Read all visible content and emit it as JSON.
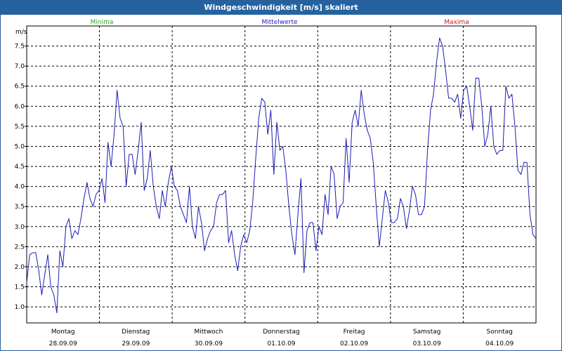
{
  "window": {
    "title": "Windgeschwindigkeit [m/s] skaliert"
  },
  "legend": {
    "min_label": "Minima",
    "mean_label": "Mittelwerte",
    "max_label": "Maxima",
    "min_color": "#22aa22",
    "mean_color": "#2020c0",
    "max_color": "#c02020"
  },
  "chart_data": {
    "type": "line",
    "title": "Windgeschwindigkeit [m/s] skaliert",
    "xlabel": "",
    "ylabel": "m/s",
    "ylim": [
      0.6,
      8.0
    ],
    "y_ticks": [
      "1.0",
      "1.5",
      "2.0",
      "2.5",
      "3.0",
      "3.5",
      "4.0",
      "4.5",
      "5.0",
      "5.5",
      "6.0",
      "6.5",
      "7.0",
      "7.5"
    ],
    "x_range_days": [
      0,
      7
    ],
    "day_labels": [
      {
        "day": "Montag",
        "date": "28.09.09"
      },
      {
        "day": "Dienstag",
        "date": "29.09.09"
      },
      {
        "day": "Mittwoch",
        "date": "30.09.09"
      },
      {
        "day": "Donnerstag",
        "date": "01.10.09"
      },
      {
        "day": "Freitag",
        "date": "02.10.09"
      },
      {
        "day": "Samstag",
        "date": "03.10.09"
      },
      {
        "day": "Sonntag",
        "date": "04.10.09"
      }
    ],
    "grid": true,
    "series": [
      {
        "name": "Mittelwerte",
        "color": "#1c1cb4",
        "values": [
          1.6,
          2.3,
          2.35,
          2.35,
          1.9,
          1.3,
          1.8,
          2.3,
          1.5,
          1.3,
          0.85,
          2.4,
          2.0,
          3.0,
          3.2,
          2.7,
          2.9,
          2.8,
          3.2,
          3.7,
          4.1,
          3.7,
          3.5,
          3.8,
          3.9,
          4.2,
          3.6,
          5.1,
          4.5,
          5.3,
          6.4,
          5.7,
          5.5,
          4.0,
          4.8,
          4.8,
          4.3,
          4.9,
          5.6,
          3.9,
          4.2,
          4.9,
          4.0,
          3.5,
          3.2,
          3.9,
          3.5,
          4.1,
          4.5,
          4.0,
          3.9,
          3.5,
          3.3,
          3.1,
          4.0,
          3.0,
          2.7,
          3.5,
          3.1,
          2.4,
          2.7,
          2.9,
          3.0,
          3.6,
          3.8,
          3.8,
          3.9,
          2.6,
          2.9,
          2.3,
          1.9,
          2.5,
          2.8,
          2.6,
          2.9,
          3.6,
          4.7,
          5.7,
          6.2,
          6.1,
          5.3,
          5.9,
          4.3,
          5.6,
          4.9,
          5.0,
          4.4,
          3.5,
          2.8,
          2.3,
          3.3,
          4.2,
          1.85,
          2.9,
          3.1,
          3.1,
          2.4,
          3.0,
          2.8,
          3.8,
          3.3,
          4.5,
          4.3,
          3.2,
          3.5,
          3.6,
          5.2,
          4.1,
          5.6,
          5.9,
          5.5,
          6.4,
          5.8,
          5.4,
          5.2,
          4.6,
          3.5,
          2.5,
          3.2,
          3.9,
          3.6,
          3.1,
          3.1,
          3.2,
          3.7,
          3.5,
          2.95,
          3.4,
          4.0,
          3.8,
          3.3,
          3.3,
          3.5,
          4.9,
          5.9,
          6.3,
          7.1,
          7.7,
          7.5,
          6.9,
          6.2,
          6.2,
          6.1,
          6.3,
          5.7,
          6.4,
          6.5,
          6.0,
          5.4,
          6.7,
          6.7,
          6.0,
          5.0,
          5.3,
          6.0,
          5.0,
          4.8,
          4.9,
          4.9,
          6.5,
          6.2,
          6.3,
          5.5,
          4.4,
          4.3,
          4.6,
          4.6,
          3.3,
          2.8,
          2.7
        ]
      }
    ]
  }
}
